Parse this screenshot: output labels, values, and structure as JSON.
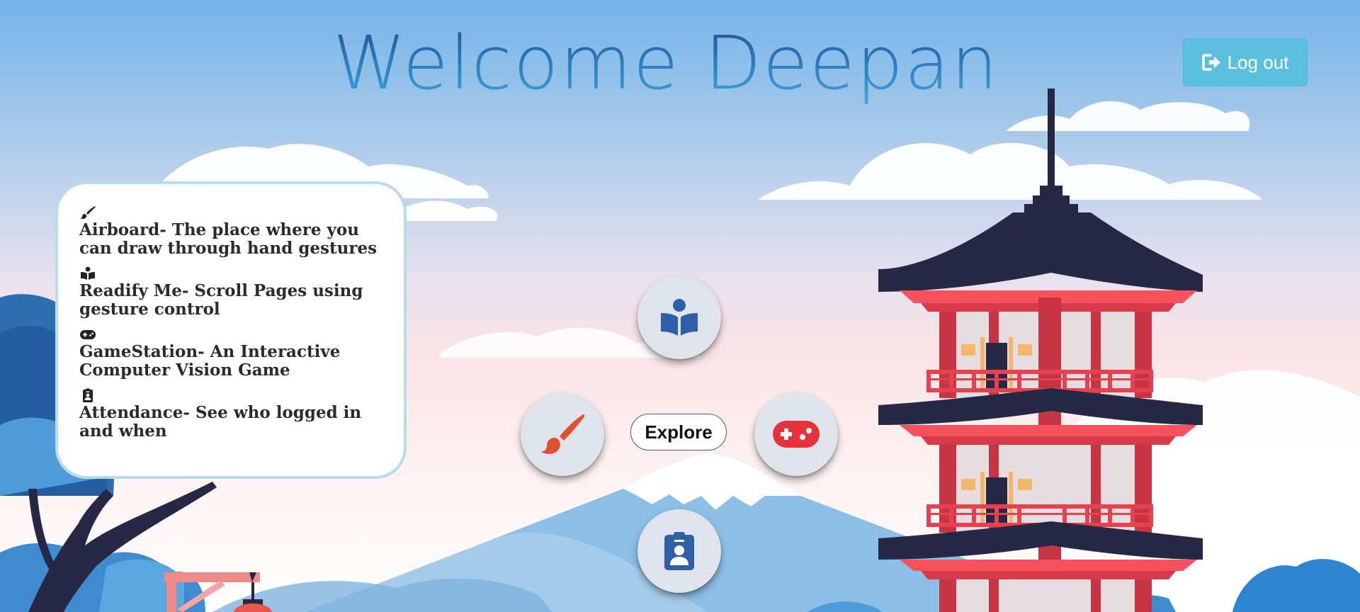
{
  "header": {
    "title": "Welcome Deepan"
  },
  "logout_button": {
    "label": "Log out",
    "icon": "sign-out-icon"
  },
  "info_card": {
    "items": [
      {
        "icon": "paint-brush-icon",
        "text": "Airboard- The place where you can draw through hand gestures"
      },
      {
        "icon": "book-reader-icon",
        "text": "Readify Me- Scroll Pages using gesture control"
      },
      {
        "icon": "gamepad-icon",
        "text": "GameStation- An Interactive Computer Vision Game"
      },
      {
        "icon": "id-badge-icon",
        "text": "Attendance- See who logged in and when"
      }
    ]
  },
  "menu": {
    "center_label": "Explore",
    "buttons": [
      {
        "name": "readify",
        "icon": "book-reader-icon"
      },
      {
        "name": "airboard",
        "icon": "paint-brush-icon"
      },
      {
        "name": "gamestation",
        "icon": "gamepad-icon"
      },
      {
        "name": "attendance",
        "icon": "id-badge-icon"
      }
    ]
  },
  "colors": {
    "title": "#2a78b8",
    "logout_bg": "#5bc0de",
    "book_icon": "#2f5fa7",
    "brush_icon": "#e0502e",
    "gamepad_icon": "#e5323b",
    "badge_icon": "#2f5fa7",
    "pagoda_roof": "#262845",
    "pagoda_red": "#d83a4a"
  }
}
